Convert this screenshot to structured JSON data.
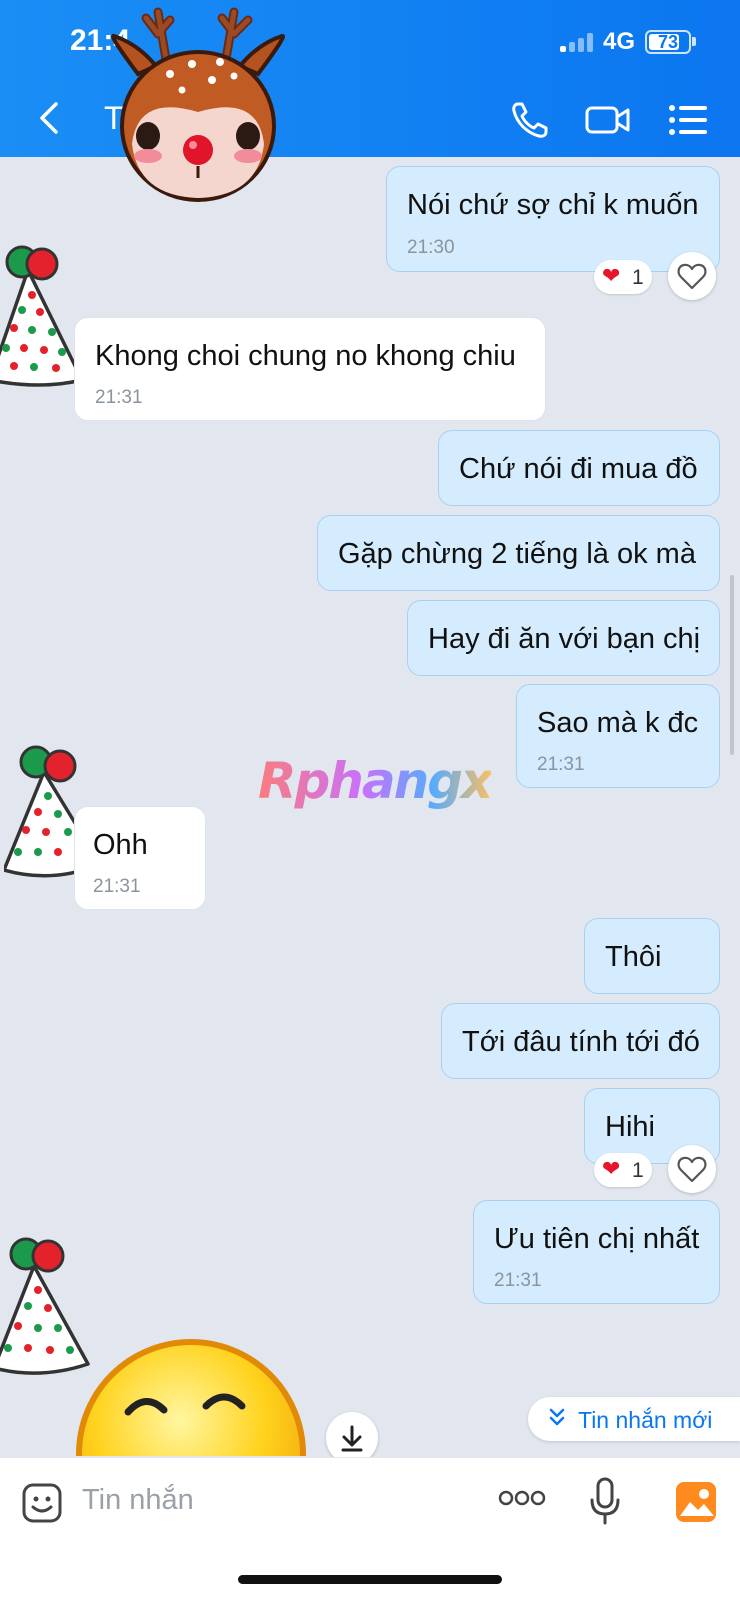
{
  "status_bar": {
    "time": "21:4",
    "network": "4G",
    "battery": "73"
  },
  "header": {
    "contact_name": "T"
  },
  "messages": [
    {
      "side": "me",
      "text": "Nói chứ sợ chỉ k muốn",
      "time": "21:30",
      "reaction": "1"
    },
    {
      "side": "them",
      "text": "Khong choi chung no khong chiu",
      "time": "21:31"
    },
    {
      "side": "me",
      "text": "Chứ nói đi mua đồ"
    },
    {
      "side": "me",
      "text": "Gặp chừng 2 tiếng là ok mà"
    },
    {
      "side": "me",
      "text": "Hay đi ăn với bạn chị"
    },
    {
      "side": "me",
      "text": "Sao mà k đc",
      "time": "21:31"
    },
    {
      "side": "them",
      "text": "Ohh",
      "time": "21:31"
    },
    {
      "side": "me",
      "text": "Thôi"
    },
    {
      "side": "me",
      "text": "Tới đâu tính tới đó"
    },
    {
      "side": "me",
      "text": "Hihi",
      "reaction": "1"
    },
    {
      "side": "me",
      "text": "Ưu tiên chị nhất",
      "time": "21:31"
    }
  ],
  "watermark": "Rphangx",
  "new_messages_label": "Tin nhắn mới",
  "input": {
    "placeholder": "Tin nhắn"
  },
  "colors": {
    "header": "#0b76f0",
    "my_bubble": "#d4ecfd",
    "their_bubble": "#ffffff",
    "background": "#e2e7ef",
    "accent": "#0b76f0"
  }
}
